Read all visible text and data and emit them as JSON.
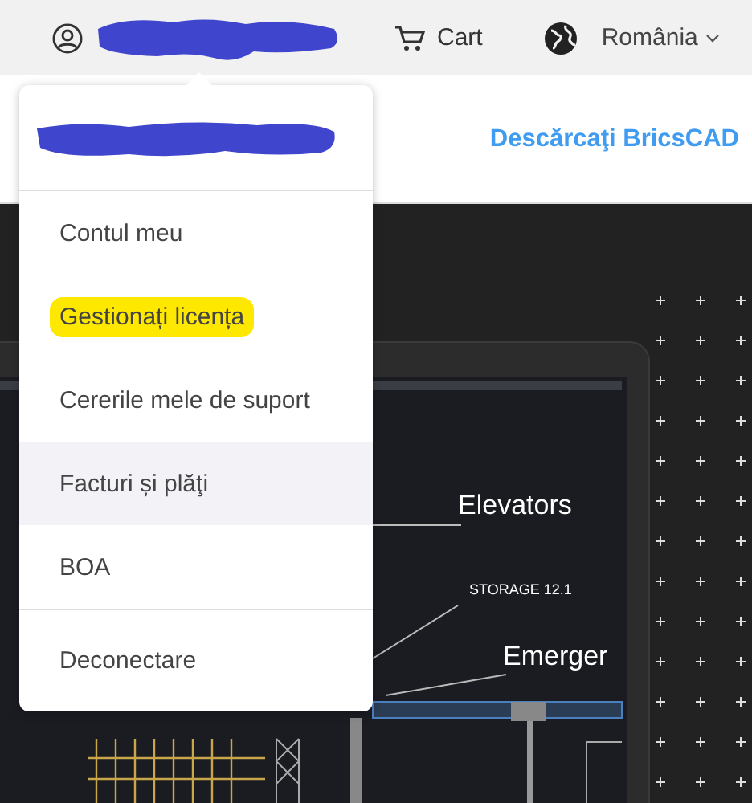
{
  "top_bar": {
    "account": {
      "name_redacted": true
    },
    "cart": {
      "label": "Cart"
    },
    "region": {
      "label": "România"
    }
  },
  "sub_bar": {
    "download_link": "Descărcaţi BricsCAD"
  },
  "hero": {
    "cad_labels": [
      {
        "text": "Elevators",
        "kind": "large"
      },
      {
        "text": "STORAGE 12.1",
        "kind": "small"
      },
      {
        "text": "Emerger",
        "kind": "large"
      }
    ]
  },
  "account_menu": {
    "header_redacted": true,
    "items": [
      {
        "label": "Contul meu",
        "highlighted": false,
        "hovered": false,
        "divider_before": false
      },
      {
        "label": "Gestionați licența",
        "highlighted": true,
        "hovered": false,
        "divider_before": false
      },
      {
        "label": "Cererile mele de suport",
        "highlighted": false,
        "hovered": false,
        "divider_before": false
      },
      {
        "label": "Facturi și plăţi",
        "highlighted": false,
        "hovered": true,
        "divider_before": false
      },
      {
        "label": "BOA",
        "highlighted": false,
        "hovered": false,
        "divider_before": false
      },
      {
        "label": "Deconectare",
        "highlighted": false,
        "hovered": false,
        "divider_before": true
      }
    ]
  }
}
